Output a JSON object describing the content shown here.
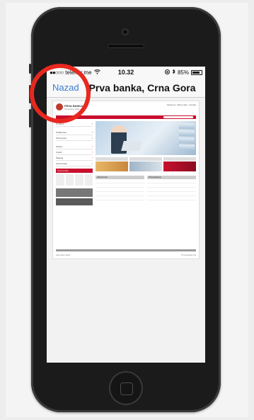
{
  "status_bar": {
    "signal": "●●○○○",
    "carrier": "telenor.me",
    "time": "10.32",
    "battery": "85%",
    "battery_level": 0.85
  },
  "nav_bar": {
    "back_label": "Nazad",
    "title": "Prva banka, Crna Gora"
  },
  "web_page": {
    "logo_name": "PRVA BANKA CG",
    "logo_sub": "Osnovana 1901",
    "top_links": [
      "Naslovna",
      "Mapa sajta",
      "Kontakt"
    ],
    "left_menu": [
      "O nama",
      "Fizička lica",
      "Pravna lica",
      "Kartice",
      "Krediti",
      "Štednja",
      "Kursna lista"
    ],
    "red_box_title": "Kursna lista",
    "news_left_title": "Aktuelnosti",
    "news_right_title": "Obavještenja",
    "footer_date": "Ažurirano 2014",
    "footer_right": "Prva banka CG"
  },
  "colors": {
    "accent_red": "#c8102e",
    "link_blue": "#3a7bd5",
    "highlight_circle": "#e8281f"
  }
}
